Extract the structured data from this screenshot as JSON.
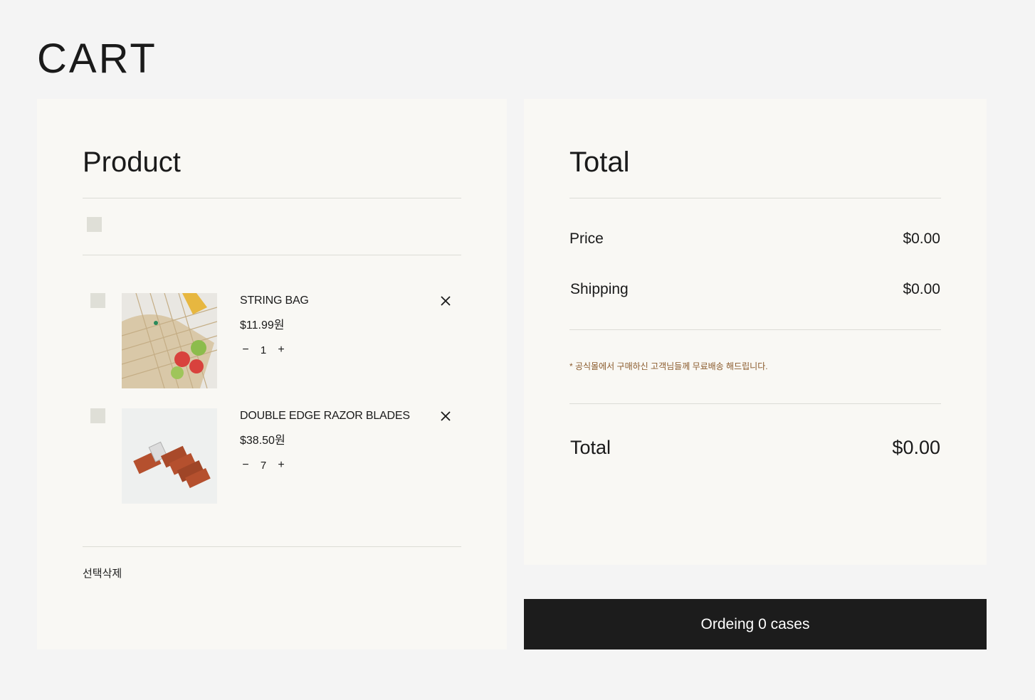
{
  "page": {
    "title": "CART"
  },
  "product_panel": {
    "heading": "Product",
    "items": [
      {
        "name": "STRING BAG",
        "price": "$11.99원",
        "quantity": "1"
      },
      {
        "name": "DOUBLE EDGE RAZOR BLADES",
        "price": "$38.50원",
        "quantity": "7"
      }
    ],
    "qty_minus": "−",
    "qty_plus": "+",
    "delete_selected_label": "선택삭제"
  },
  "total_panel": {
    "heading": "Total",
    "price_label": "Price",
    "price_value": "$0.00",
    "shipping_label": "Shipping",
    "shipping_value": "$0.00",
    "notice": "* 공식몰에서 구매하신 고객님들께 무료배송 해드립니다.",
    "total_label": "Total",
    "total_value": "$0.00"
  },
  "order_button": {
    "label": "Ordeing 0 cases"
  },
  "colors": {
    "accent": "#1c1c1c",
    "panel": "#f9f8f4",
    "notice": "#8a5a2b",
    "checkbox": "#dfdfd7"
  },
  "icons": [
    "close-icon",
    "minus-icon",
    "plus-icon"
  ]
}
